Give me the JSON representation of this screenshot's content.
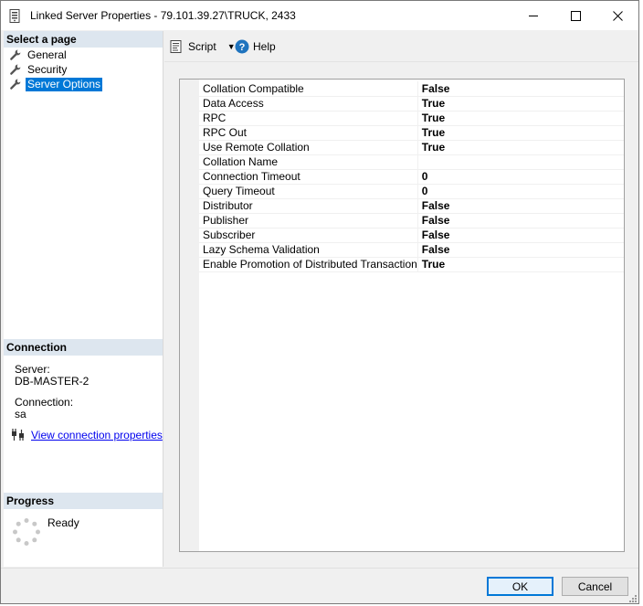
{
  "window": {
    "title": "Linked Server Properties - 79.101.39.27\\TRUCK, 2433"
  },
  "title_buttons": {
    "minimize_icon": "minimize-icon",
    "maximize_icon": "maximize-icon",
    "close_icon": "close-icon"
  },
  "sidebar": {
    "select_header": "Select a page",
    "items": [
      {
        "label": "General",
        "icon": "wrench-icon",
        "selected": false
      },
      {
        "label": "Security",
        "icon": "wrench-icon",
        "selected": false
      },
      {
        "label": "Server Options",
        "icon": "wrench-icon",
        "selected": true
      }
    ],
    "connection_header": "Connection",
    "server_label": "Server:",
    "server_value": "DB-MASTER-2",
    "connection_label": "Connection:",
    "connection_value": "sa",
    "view_connection_link": "View connection properties",
    "progress_header": "Progress",
    "progress_status": "Ready"
  },
  "toolbar": {
    "script_label": "Script",
    "help_label": "Help"
  },
  "properties": [
    {
      "name": "Collation Compatible",
      "value": "False"
    },
    {
      "name": "Data Access",
      "value": "True"
    },
    {
      "name": "RPC",
      "value": "True"
    },
    {
      "name": "RPC Out",
      "value": "True"
    },
    {
      "name": "Use Remote Collation",
      "value": "True"
    },
    {
      "name": "Collation Name",
      "value": ""
    },
    {
      "name": "Connection Timeout",
      "value": "0"
    },
    {
      "name": "Query Timeout",
      "value": "0"
    },
    {
      "name": "Distributor",
      "value": "False"
    },
    {
      "name": "Publisher",
      "value": "False"
    },
    {
      "name": "Subscriber",
      "value": "False"
    },
    {
      "name": "Lazy Schema Validation",
      "value": "False"
    },
    {
      "name": "Enable Promotion of Distributed Transaction",
      "value": "True"
    }
  ],
  "buttons": {
    "ok_label": "OK",
    "cancel_label": "Cancel"
  },
  "colors": {
    "selection": "#0078d7",
    "section_header": "#dde6ef",
    "link": "#0000ee",
    "help_icon": "#1e73be"
  }
}
